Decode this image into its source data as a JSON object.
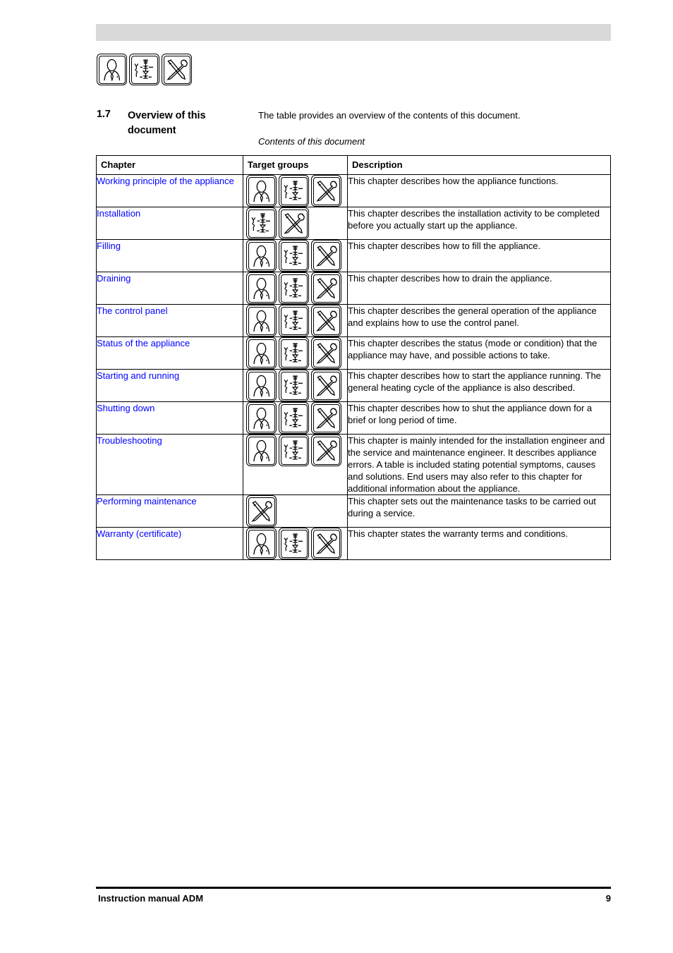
{
  "header": {
    "bar_color": "#d9d9d9",
    "target_group_icons": [
      "user-icon",
      "installer-icon",
      "service-icon"
    ]
  },
  "section": {
    "number": "1.7",
    "title": "Overview of this document",
    "intro": "The table provides an overview of the contents of this document.",
    "caption": "Contents of this document"
  },
  "table": {
    "columns": [
      "Chapter",
      "Target groups",
      "Description"
    ],
    "link_color": "#0000ff",
    "rows": [
      {
        "chapter": "Working principle of the appliance",
        "icons": [
          "user-icon",
          "installer-icon",
          "service-icon"
        ],
        "description": "This chapter describes how the appliance functions."
      },
      {
        "chapter": "Installation",
        "icons": [
          "installer-icon",
          "service-icon"
        ],
        "description": "This chapter describes the installation activity to be completed before you actually start up the appliance."
      },
      {
        "chapter": "Filling",
        "icons": [
          "user-icon",
          "installer-icon",
          "service-icon"
        ],
        "description": "This chapter describes how to fill the appliance."
      },
      {
        "chapter": "Draining",
        "icons": [
          "user-icon",
          "installer-icon",
          "service-icon"
        ],
        "description": "This chapter describes how to drain the appliance."
      },
      {
        "chapter": "The control panel",
        "icons": [
          "user-icon",
          "installer-icon",
          "service-icon"
        ],
        "description": "This chapter describes the general operation of the appliance and explains how to use the control panel."
      },
      {
        "chapter": "Status of the appliance",
        "icons": [
          "user-icon",
          "installer-icon",
          "service-icon"
        ],
        "description": "This chapter describes the status (mode or condition) that the appliance may have, and possible actions to take."
      },
      {
        "chapter": "Starting and running",
        "icons": [
          "user-icon",
          "installer-icon",
          "service-icon"
        ],
        "description": "This chapter describes how to start the appliance running. The general heating cycle of the appliance is also described."
      },
      {
        "chapter": "Shutting down",
        "icons": [
          "user-icon",
          "installer-icon",
          "service-icon"
        ],
        "description": "This chapter describes how to shut the appliance down for a brief or long period of time."
      },
      {
        "chapter": "Troubleshooting",
        "icons": [
          "user-icon",
          "installer-icon",
          "service-icon"
        ],
        "description": "This chapter is mainly intended for the installation engineer and the service and maintenance engineer. It describes appliance errors. A table is included stating potential symptoms, causes and solutions. End users may also refer to this chapter for additional information about the appliance."
      },
      {
        "chapter": "Performing maintenance",
        "icons": [
          "service-icon"
        ],
        "description": "This chapter sets out the maintenance tasks to be carried out during a service."
      },
      {
        "chapter": "Warranty (certificate)",
        "icons": [
          "user-icon",
          "installer-icon",
          "service-icon"
        ],
        "description": "This chapter states the warranty terms and conditions."
      }
    ]
  },
  "footer": {
    "left": "Instruction manual ADM",
    "page": "9"
  }
}
